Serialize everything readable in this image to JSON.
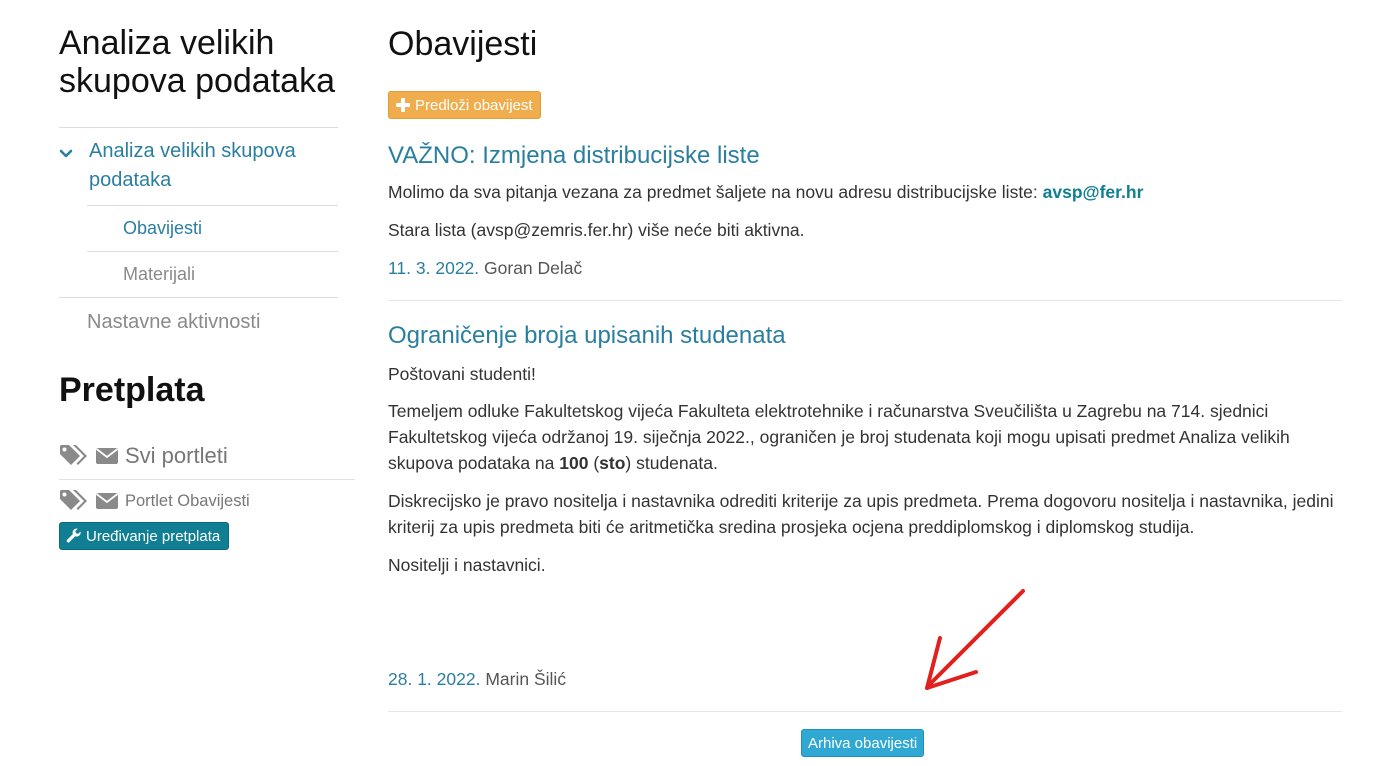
{
  "sidebar": {
    "course_title": "Analiza velikih skupova podataka",
    "nav": {
      "course_label": "Analiza velikih skupova podataka",
      "sub_items": [
        {
          "label": "Obavijesti",
          "active": true
        },
        {
          "label": "Materijali",
          "active": false
        }
      ],
      "plain_item": "Nastavne aktivnosti"
    },
    "subscriptions": {
      "title": "Pretplata",
      "rows": [
        {
          "label": "Svi portleti",
          "icons": [
            "tags-icon",
            "envelope-icon"
          ]
        },
        {
          "label": "Portlet Obavijesti",
          "icons": [
            "tags-icon",
            "envelope-icon"
          ]
        }
      ],
      "edit_button": "Uređivanje pretplata",
      "edit_icon": "wrench-icon"
    }
  },
  "main": {
    "title": "Obavijesti",
    "suggest_button": "Predloži obavijest",
    "suggest_icon": "plus-icon",
    "notices": [
      {
        "title": "VAŽNO: Izmjena distribucijske liste",
        "p1_text": "Molimo da sva pitanja vezana za predmet šaljete na novu adresu distribucijske liste: ",
        "p1_link": "avsp@fer.hr",
        "p2": "Stara lista (avsp@zemris.fer.hr) više neće biti aktivna.",
        "date": "11. 3. 2022.",
        "author": "Goran Delač"
      },
      {
        "title": "Ograničenje broja upisanih studenata",
        "greeting": "Poštovani studenti!",
        "p1_a": "Temeljem odluke Fakultetskog vijeća Fakulteta elektrotehnike i računarstva Sveučilišta u Zagrebu na 714. sjednici Fakultetskog vijeća održanoj 19. siječnja 2022., ograničen je broj studenata koji mogu upisati predmet Analiza velikih skupova podataka na ",
        "p1_num": "100",
        "p1_b": " (",
        "p1_word": "sto",
        "p1_c": ") studenata.",
        "p2": "Diskrecijsko je pravo nositelja i nastavnika odrediti kriterije za upis predmeta. Prema dogovoru nositelja i nastavnika, jedini kriterij za upis predmeta biti će aritmetička sredina prosjeka ocjena preddiplomskog i diplomskog studija.",
        "p3": "Nositelji i nastavnici.",
        "date": "28. 1. 2022.",
        "author": "Marin Šilić"
      }
    ],
    "archive_button": "Arhiva obavijesti"
  },
  "colors": {
    "link": "#2a7fa0",
    "suggest_button": "#f0ad4e",
    "edit_button": "#117f93",
    "archive_button": "#2fa9d3",
    "annotation_arrow": "#e0211d"
  }
}
